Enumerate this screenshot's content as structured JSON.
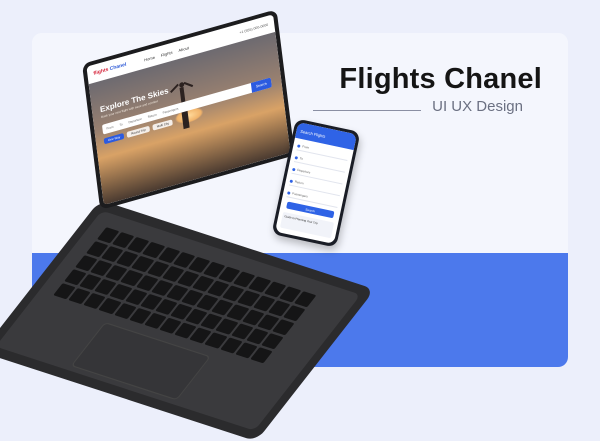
{
  "heading": {
    "title": "Flights Chanel",
    "subtitle": "UI UX Design"
  },
  "laptop_site": {
    "logo_part1": "flights",
    "logo_part2": "Chanel",
    "menu": [
      "Home",
      "Flights",
      "About"
    ],
    "contact": "+1 (555) 000-0000",
    "hero_title": "Explore The Skies",
    "hero_sub": "Book your next flight with ease and comfort",
    "search_fields": [
      "From",
      "To",
      "Departure",
      "Return",
      "Passengers"
    ],
    "search_button": "Search",
    "trip_tabs": [
      "One Way",
      "Round Trip",
      "Multi City"
    ]
  },
  "phone_app": {
    "header": "Search Flights",
    "fields": [
      "From",
      "To",
      "Departure",
      "Return",
      "Passengers"
    ],
    "button": "Search",
    "card": "Guide to Planning Your Trip"
  },
  "colors": {
    "accent": "#4c79ec",
    "background": "#eceffb",
    "brand_red": "#d6243a"
  }
}
